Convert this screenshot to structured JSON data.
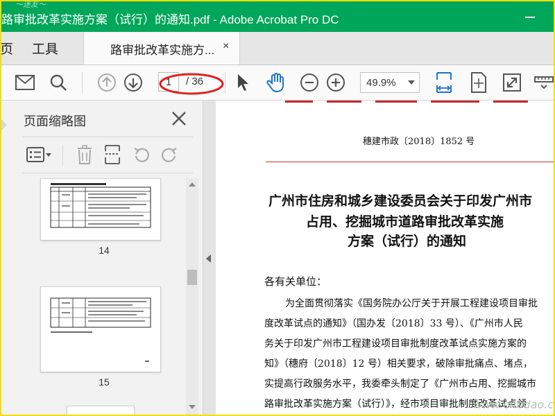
{
  "window": {
    "title": "路审批改革实施方案（试行）的通知.pdf - Adobe Acrobat Pro DC",
    "title_watermark": "～迷友～"
  },
  "menu": {
    "home_partial": "页",
    "tools": "工具",
    "tab_label": "路审批改革实施方...",
    "tab_close": "×"
  },
  "toolbar": {
    "current_page": "1",
    "total_pages": "/ 36",
    "zoom": "49.9%"
  },
  "panel": {
    "title": "页面缩略图",
    "thumbnails": [
      {
        "page": "14"
      },
      {
        "page": "15"
      }
    ]
  },
  "document": {
    "doc_number": "穗建市政〔2018〕1852 号",
    "title_lines": [
      "广州市住房和城乡建设委员会关于印发广州市",
      "占用、挖掘城市道路审批改革实施",
      "方案（试行）的通知"
    ],
    "salutation": "各有关单位：",
    "body_lines": [
      "为全面贯彻落实《国务院办公厅关于开展工程建设项目审批",
      "度改革试点的通知》（国办发〔2018〕33 号）、《广州市人民",
      "务关于印发广州市工程建设项目审批制度改革试点实施方案的",
      "知》（穗府〔2018〕12 号）相关要求，破除审批痛点、堵点，",
      "实提高行政服务水平，我委牵头制定了《广州市占用、挖掘城市",
      "路审批改革实施方案（试行）》，经市项目审批制度改革试点领"
    ]
  },
  "watermark": "www.cnbdao.com",
  "colors": {
    "titlebar": "#00a65a",
    "accent_blue": "#1a73c8",
    "red_annotation": "#e02020",
    "doc_red_line": "#d32f2f"
  },
  "icons": [
    "mail-icon",
    "search-icon",
    "arrow-up-icon",
    "arrow-down-icon",
    "pointer-icon",
    "hand-icon",
    "zoom-out-icon",
    "zoom-in-icon",
    "fit-width-icon",
    "fit-page-icon",
    "fullscreen-icon",
    "more-tools-icon",
    "close-icon",
    "options-icon",
    "trash-icon",
    "extract-icon",
    "rotate-left-icon",
    "rotate-right-icon"
  ]
}
